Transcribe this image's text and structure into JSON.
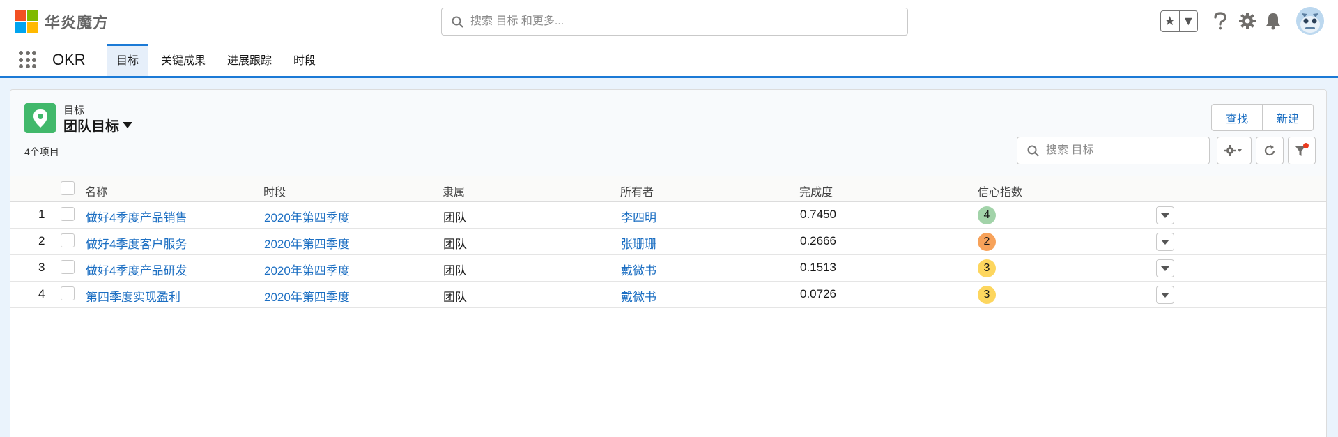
{
  "brand": {
    "name": "华炎魔方",
    "logo_colors": [
      "#f25022",
      "#7fba00",
      "#00a4ef",
      "#ffb900"
    ]
  },
  "header": {
    "search_placeholder": "搜索 目标 和更多..."
  },
  "nav": {
    "app_name": "OKR",
    "tabs": [
      {
        "label": "目标",
        "active": true
      },
      {
        "label": "关键成果",
        "active": false
      },
      {
        "label": "进展跟踪",
        "active": false
      },
      {
        "label": "时段",
        "active": false
      }
    ]
  },
  "list_view": {
    "object_type": "目标",
    "list_name": "团队目标",
    "item_count": "4个项目",
    "buttons": {
      "find": "查找",
      "new": "新建"
    },
    "search_placeholder": "搜索 目标",
    "columns": [
      "名称",
      "时段",
      "隶属",
      "所有者",
      "完成度",
      "信心指数"
    ],
    "rows": [
      {
        "num": "1",
        "name": "做好4季度产品销售",
        "period": "2020年第四季度",
        "belongs": "团队",
        "owner": "李四明",
        "completion": "0.7450",
        "confidence": "4",
        "confidence_color": "#a2d3a9"
      },
      {
        "num": "2",
        "name": "做好4季度客户服务",
        "period": "2020年第四季度",
        "belongs": "团队",
        "owner": "张珊珊",
        "completion": "0.2666",
        "confidence": "2",
        "confidence_color": "#f7a25a"
      },
      {
        "num": "3",
        "name": "做好4季度产品研发",
        "period": "2020年第四季度",
        "belongs": "团队",
        "owner": "戴微书",
        "completion": "0.1513",
        "confidence": "3",
        "confidence_color": "#fdd65e"
      },
      {
        "num": "4",
        "name": "第四季度实现盈利",
        "period": "2020年第四季度",
        "belongs": "团队",
        "owner": "戴微书",
        "completion": "0.0726",
        "confidence": "3",
        "confidence_color": "#fdd65e"
      }
    ]
  },
  "colors": {
    "accent": "#1b7ad6",
    "link": "#1b6ec2",
    "object_icon": "#41b86b",
    "filter_dot": "#ea3a1e"
  }
}
